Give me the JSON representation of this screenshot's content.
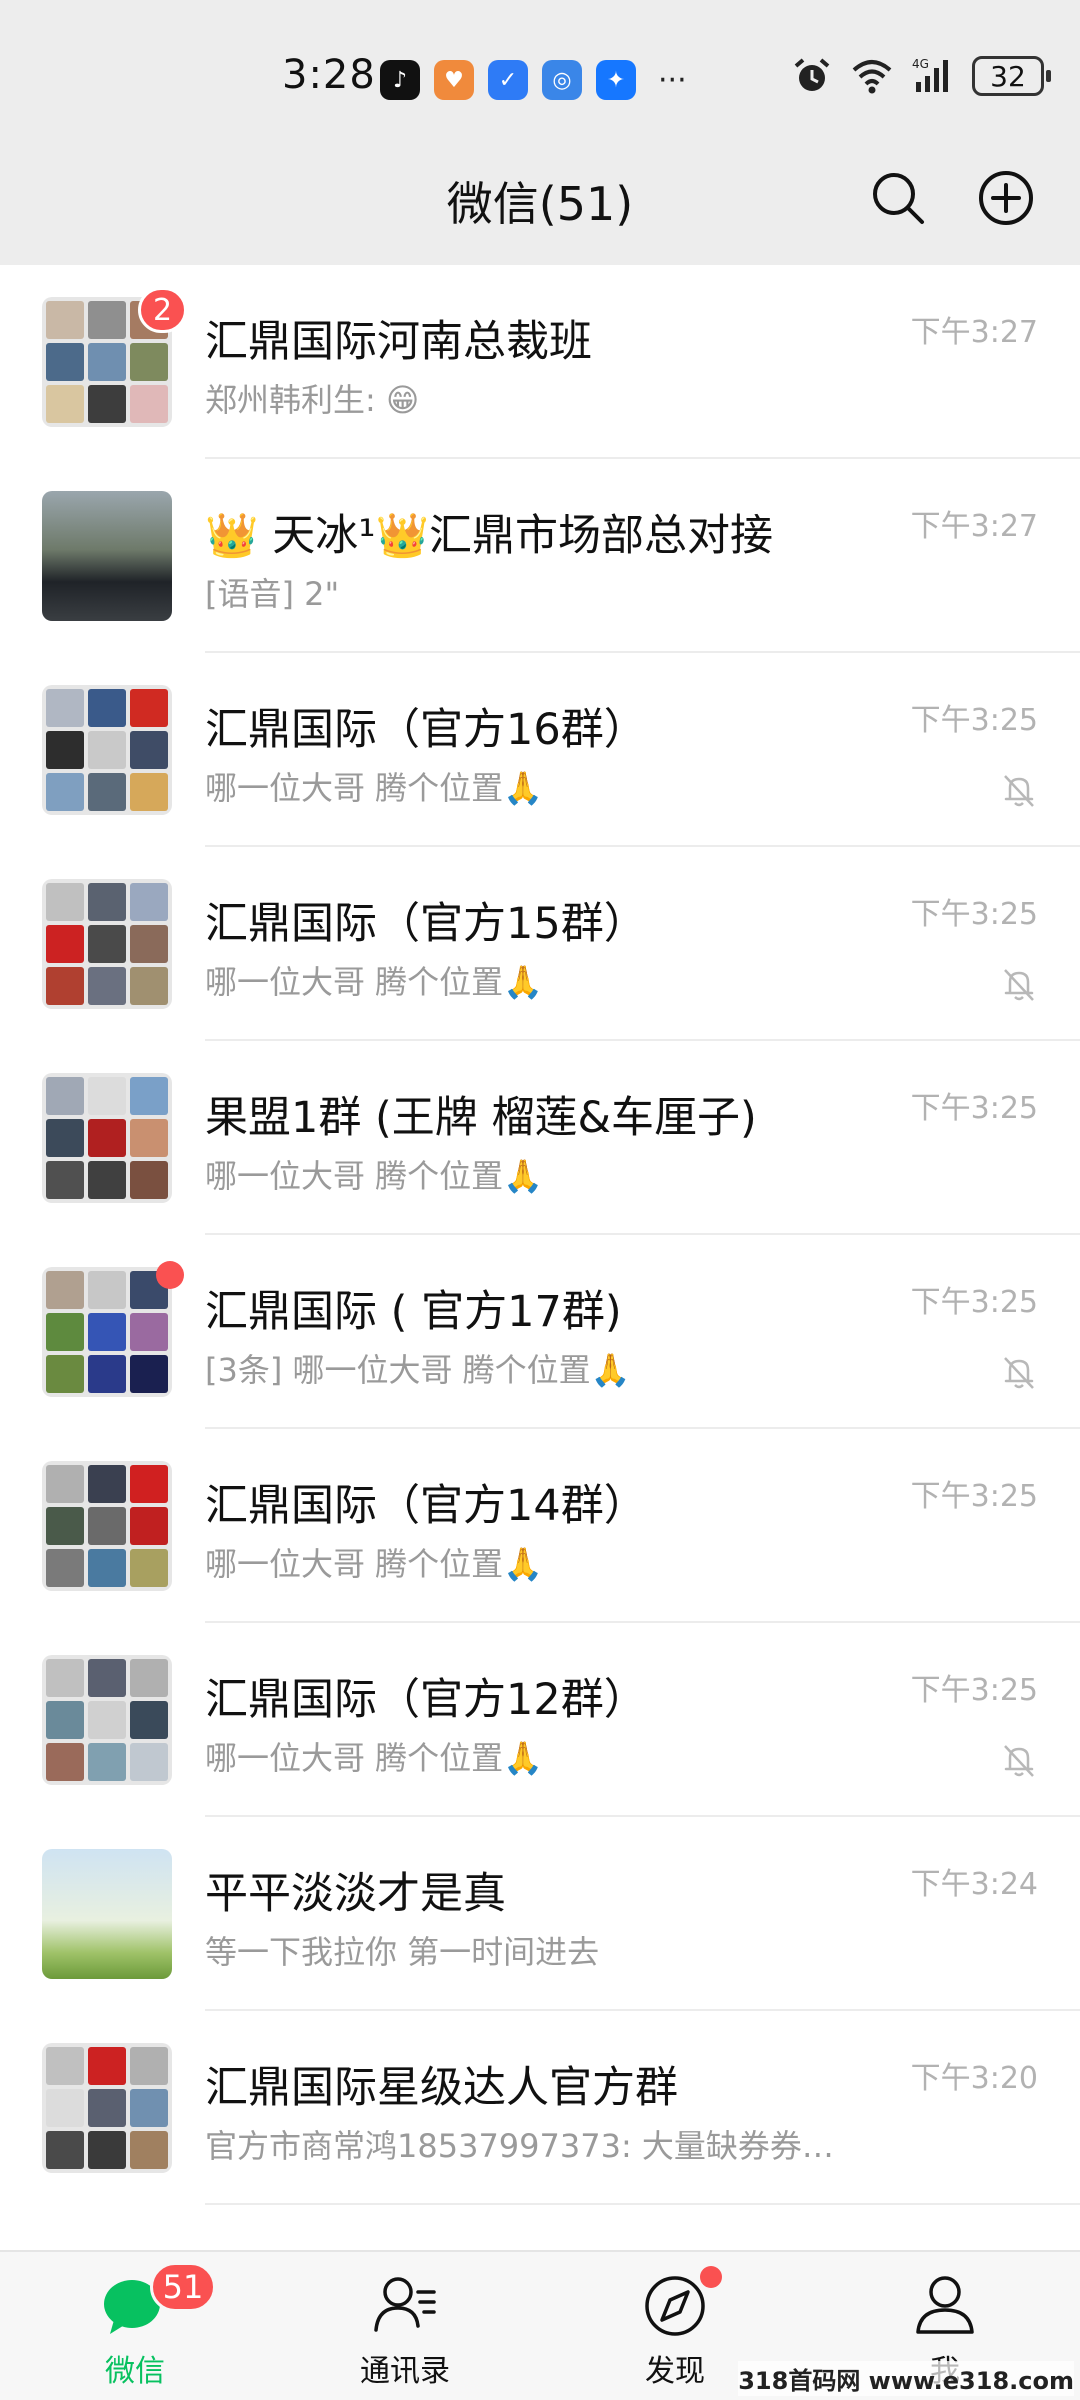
{
  "status_bar": {
    "time": "3:28",
    "network": "4G",
    "battery": "32"
  },
  "header": {
    "title": "微信(51)"
  },
  "chats": [
    {
      "title": "汇鼎国际河南总裁班",
      "subtitle": "郑州韩利生: 😁",
      "time": "下午3:27",
      "badge": "2",
      "muted": false
    },
    {
      "title": "👑 天冰¹👑汇鼎市场部总对接",
      "subtitle": "[语音] 2\"",
      "time": "下午3:27",
      "badge": "",
      "muted": false
    },
    {
      "title": "汇鼎国际（官方16群）",
      "subtitle": "哪一位大哥 腾个位置🙏",
      "time": "下午3:25",
      "badge": "",
      "muted": true
    },
    {
      "title": "汇鼎国际（官方15群）",
      "subtitle": "哪一位大哥 腾个位置🙏",
      "time": "下午3:25",
      "badge": "",
      "muted": true
    },
    {
      "title": "果盟1群 (王牌 榴莲&车厘子)",
      "subtitle": "哪一位大哥 腾个位置🙏",
      "time": "下午3:25",
      "badge": "",
      "muted": false
    },
    {
      "title": "汇鼎国际 ( 官方17群)",
      "subtitle": "[3条] 哪一位大哥 腾个位置🙏",
      "time": "下午3:25",
      "badge": "dot",
      "muted": true
    },
    {
      "title": "汇鼎国际（官方14群）",
      "subtitle": "哪一位大哥 腾个位置🙏",
      "time": "下午3:25",
      "badge": "",
      "muted": false
    },
    {
      "title": "汇鼎国际（官方12群）",
      "subtitle": "哪一位大哥 腾个位置🙏",
      "time": "下午3:25",
      "badge": "",
      "muted": true
    },
    {
      "title": "平平淡淡才是真",
      "subtitle": "等一下我拉你  第一时间进去",
      "time": "下午3:24",
      "badge": "",
      "muted": false
    },
    {
      "title": "汇鼎国际星级达人官方群",
      "subtitle": "官方市商常鸿18537997373: 大量缺券券…",
      "time": "下午3:20",
      "badge": "",
      "muted": false
    }
  ],
  "tabbar": {
    "tabs": [
      {
        "label": "微信",
        "badge": "51"
      },
      {
        "label": "通讯录"
      },
      {
        "label": "发现"
      },
      {
        "label": "我"
      }
    ]
  },
  "watermark": "318首码网 www.e318.com",
  "colors": {
    "accent_green": "#07c160",
    "badge_red": "#fa5151",
    "header_bg": "#ededed"
  }
}
